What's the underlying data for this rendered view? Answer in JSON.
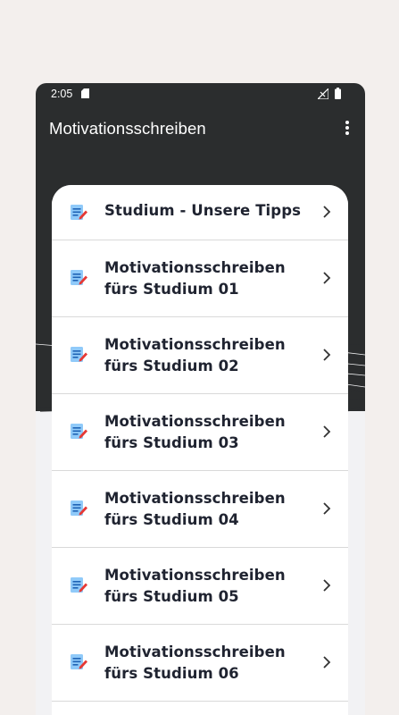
{
  "status_bar": {
    "time": "2:05"
  },
  "app_bar": {
    "title": "Motivationsschreiben",
    "overflow_icon": "more-vertical-icon"
  },
  "list": {
    "item_icon": "document-edit-icon",
    "chevron_icon": "chevron-right-icon",
    "items": [
      {
        "label": "Studium - Unsere Tipps"
      },
      {
        "label": "Motivationsschreiben fürs Studium 01"
      },
      {
        "label": "Motivationsschreiben fürs Studium 02"
      },
      {
        "label": "Motivationsschreiben fürs Studium 03"
      },
      {
        "label": "Motivationsschreiben fürs Studium 04"
      },
      {
        "label": "Motivationsschreiben fürs Studium 05"
      },
      {
        "label": "Motivationsschreiben fürs Studium 06"
      }
    ]
  },
  "colors": {
    "header_background": "#2b2d2e",
    "page_background": "#f3efed",
    "text": "#1f2330",
    "icon_accent": "#e53935",
    "icon_paper": "#64b5f6"
  }
}
